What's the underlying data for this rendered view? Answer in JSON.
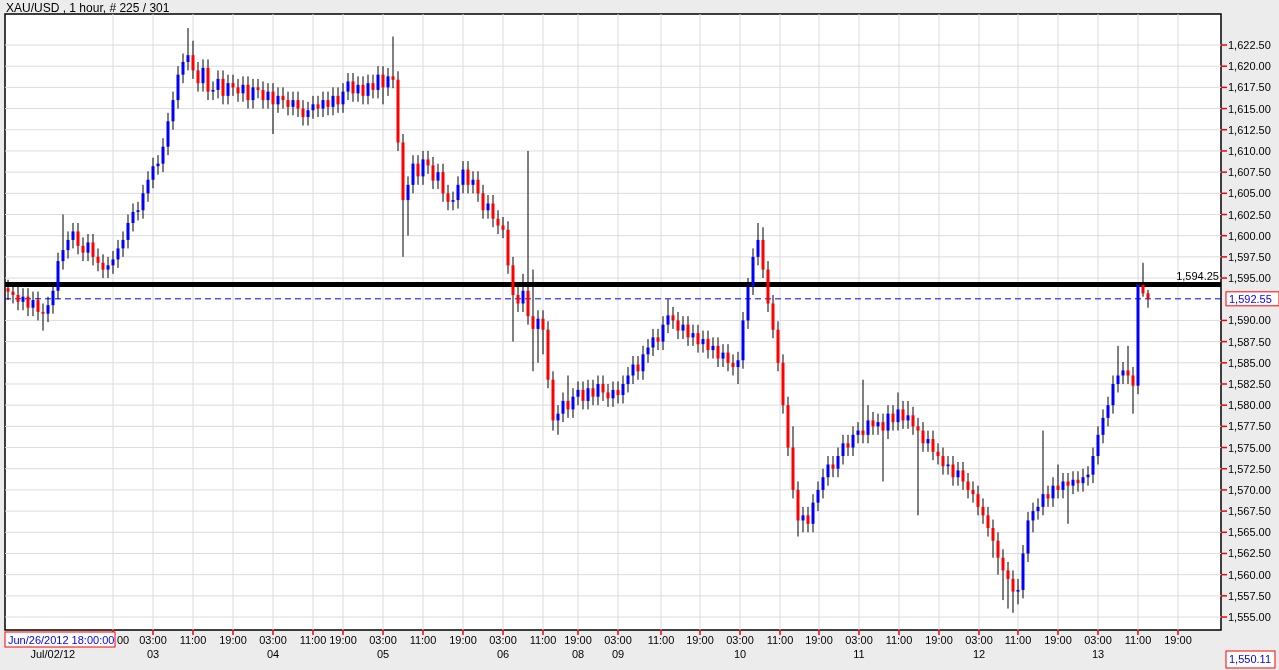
{
  "chart_title": "XAU/USD , 1 hour, # 225 / 301",
  "chart": {
    "chart_data": {
      "type": "candlestick",
      "categories": [
        null,
        null,
        null,
        null,
        null,
        null,
        null,
        null,
        null,
        null,
        null,
        null,
        null,
        null,
        null,
        null,
        null,
        null,
        null,
        null,
        null,
        null,
        null,
        null,
        null,
        null,
        null,
        null,
        null,
        null,
        null,
        null,
        null,
        null,
        null,
        null,
        null,
        null,
        null,
        null,
        null,
        null,
        null,
        null,
        null,
        null,
        null,
        null,
        null,
        null,
        null,
        null,
        null,
        null,
        null,
        null,
        null,
        null,
        null,
        null,
        null,
        null,
        null,
        null,
        null,
        null,
        null,
        null,
        null,
        null,
        null,
        null,
        null,
        null,
        null,
        null,
        null,
        null,
        null,
        null,
        null,
        null,
        null,
        null,
        null,
        null,
        null,
        null,
        null,
        null,
        null,
        null,
        null,
        null,
        null,
        null,
        null,
        null,
        null,
        null,
        null,
        null,
        null,
        null,
        null,
        null,
        null,
        null,
        null,
        null,
        null,
        null,
        null,
        null,
        null,
        null,
        null,
        null,
        null,
        null,
        null,
        null,
        null,
        null,
        null,
        null,
        null,
        null,
        null,
        null,
        null,
        null,
        null,
        null,
        null,
        null,
        null,
        null,
        null,
        null,
        null,
        null,
        null,
        null,
        null,
        null,
        null,
        null,
        null,
        null,
        null,
        null,
        null,
        null,
        null,
        null,
        null,
        null,
        null,
        null,
        null,
        null,
        null,
        null,
        null,
        null,
        null,
        null,
        null,
        null,
        null,
        null,
        null,
        null,
        null,
        null,
        null,
        null,
        null,
        null,
        null,
        null,
        null,
        null,
        null,
        null,
        null,
        null,
        null,
        null,
        null,
        null,
        null,
        null,
        null,
        null,
        null,
        null,
        null,
        null,
        null,
        null,
        null,
        null,
        null,
        null,
        null,
        null,
        null,
        null,
        null,
        null,
        null,
        null,
        null,
        null,
        null,
        null,
        null,
        null,
        null,
        null,
        null,
        null,
        null,
        null,
        null,
        null,
        null,
        null,
        null,
        null,
        null,
        null,
        null,
        null,
        null,
        null,
        null,
        null,
        null,
        null,
        null
      ],
      "ohlc": [
        [
          1593.8,
          1594.8,
          1592.4,
          1593.4
        ],
        [
          1593.4,
          1594.4,
          1592.0,
          1593.0
        ],
        [
          1593.0,
          1594.0,
          1591.2,
          1592.2
        ],
        [
          1592.2,
          1593.8,
          1591.2,
          1592.8
        ],
        [
          1592.8,
          1593.8,
          1590.5,
          1591.5
        ],
        [
          1591.5,
          1593.4,
          1590.5,
          1592.4
        ],
        [
          1592.4,
          1593.4,
          1590.0,
          1591.0
        ],
        [
          1591.0,
          1592.0,
          1588.8,
          1590.8
        ],
        [
          1590.8,
          1592.8,
          1589.8,
          1591.8
        ],
        [
          1591.8,
          1594.5,
          1590.8,
          1593.5
        ],
        [
          1593.5,
          1598.0,
          1592.5,
          1597.0
        ],
        [
          1597.0,
          1602.5,
          1596.0,
          1598.3
        ],
        [
          1598.3,
          1600.5,
          1597.3,
          1599.5
        ],
        [
          1599.5,
          1601.5,
          1598.5,
          1600.5
        ],
        [
          1600.5,
          1601.5,
          1597.8,
          1598.8
        ],
        [
          1598.8,
          1599.8,
          1597.0,
          1598.0
        ],
        [
          1598.0,
          1600.2,
          1597.0,
          1599.2
        ],
        [
          1599.2,
          1600.2,
          1596.5,
          1597.5
        ],
        [
          1597.5,
          1598.5,
          1595.8,
          1596.8
        ],
        [
          1596.8,
          1597.8,
          1595.0,
          1596.0
        ],
        [
          1596.0,
          1597.5,
          1595.0,
          1596.5
        ],
        [
          1596.5,
          1598.2,
          1595.5,
          1597.2
        ],
        [
          1597.2,
          1599.5,
          1596.2,
          1598.5
        ],
        [
          1598.5,
          1600.5,
          1597.5,
          1599.5
        ],
        [
          1599.5,
          1602.5,
          1598.5,
          1601.5
        ],
        [
          1601.5,
          1603.8,
          1600.5,
          1602.8
        ],
        [
          1602.8,
          1604.0,
          1601.8,
          1603.0
        ],
        [
          1603.0,
          1606.0,
          1602.0,
          1605.0
        ],
        [
          1605.0,
          1607.6,
          1604.0,
          1606.6
        ],
        [
          1606.6,
          1609.2,
          1605.6,
          1608.2
        ],
        [
          1608.2,
          1609.5,
          1607.2,
          1608.5
        ],
        [
          1608.5,
          1611.5,
          1607.5,
          1610.5
        ],
        [
          1610.5,
          1614.5,
          1609.5,
          1613.5
        ],
        [
          1613.5,
          1617.0,
          1612.5,
          1616.0
        ],
        [
          1616.0,
          1620.0,
          1615.0,
          1619.0
        ],
        [
          1619.0,
          1621.5,
          1618.0,
          1620.5
        ],
        [
          1620.5,
          1624.5,
          1619.5,
          1621.3
        ],
        [
          1621.3,
          1623.0,
          1618.5,
          1619.5
        ],
        [
          1619.5,
          1620.5,
          1617.0,
          1618.0
        ],
        [
          1618.0,
          1620.8,
          1617.0,
          1619.8
        ],
        [
          1619.8,
          1620.8,
          1616.0,
          1617.0
        ],
        [
          1617.0,
          1618.2,
          1616.0,
          1617.2
        ],
        [
          1617.2,
          1619.5,
          1616.2,
          1618.5
        ],
        [
          1618.5,
          1619.5,
          1615.5,
          1616.5
        ],
        [
          1616.5,
          1619.0,
          1615.5,
          1618.0
        ],
        [
          1618.0,
          1619.0,
          1616.5,
          1617.5
        ],
        [
          1617.5,
          1618.5,
          1615.8,
          1616.8
        ],
        [
          1616.8,
          1618.8,
          1615.8,
          1617.8
        ],
        [
          1617.8,
          1618.8,
          1615.0,
          1616.0
        ],
        [
          1616.0,
          1618.5,
          1615.0,
          1617.5
        ],
        [
          1617.5,
          1618.5,
          1616.2,
          1617.2
        ],
        [
          1617.2,
          1618.2,
          1615.0,
          1616.0
        ],
        [
          1616.0,
          1618.0,
          1615.0,
          1617.0
        ],
        [
          1617.0,
          1618.0,
          1612.0,
          1615.5
        ],
        [
          1615.5,
          1617.5,
          1614.5,
          1616.5
        ],
        [
          1616.5,
          1617.5,
          1615.0,
          1616.0
        ],
        [
          1616.0,
          1617.0,
          1614.2,
          1615.2
        ],
        [
          1615.2,
          1617.0,
          1614.2,
          1616.0
        ],
        [
          1616.0,
          1617.0,
          1614.0,
          1615.0
        ],
        [
          1615.0,
          1616.0,
          1613.0,
          1614.0
        ],
        [
          1614.0,
          1615.8,
          1613.0,
          1614.8
        ],
        [
          1614.8,
          1616.5,
          1613.8,
          1615.5
        ],
        [
          1615.5,
          1616.5,
          1614.0,
          1615.0
        ],
        [
          1615.0,
          1617.0,
          1614.0,
          1616.0
        ],
        [
          1616.0,
          1617.0,
          1614.2,
          1615.2
        ],
        [
          1615.2,
          1617.5,
          1614.2,
          1616.5
        ],
        [
          1616.5,
          1617.5,
          1614.5,
          1615.5
        ],
        [
          1615.5,
          1618.0,
          1614.5,
          1617.0
        ],
        [
          1617.0,
          1619.2,
          1616.0,
          1618.2
        ],
        [
          1618.2,
          1619.2,
          1615.8,
          1616.8
        ],
        [
          1616.8,
          1618.8,
          1615.8,
          1617.8
        ],
        [
          1617.8,
          1618.8,
          1615.5,
          1616.5
        ],
        [
          1616.5,
          1619.0,
          1615.5,
          1618.0
        ],
        [
          1618.0,
          1619.0,
          1616.2,
          1617.2
        ],
        [
          1617.2,
          1620.0,
          1616.2,
          1619.0
        ],
        [
          1619.0,
          1620.0,
          1615.5,
          1617.5
        ],
        [
          1617.5,
          1619.8,
          1616.5,
          1618.8
        ],
        [
          1618.8,
          1623.5,
          1617.4,
          1618.4
        ],
        [
          1618.4,
          1619.4,
          1610.0,
          1611.0
        ],
        [
          1611.0,
          1612.0,
          1597.5,
          1604.2
        ],
        [
          1604.2,
          1607.0,
          1600.0,
          1606.0
        ],
        [
          1606.0,
          1609.5,
          1605.0,
          1608.5
        ],
        [
          1608.5,
          1609.5,
          1606.0,
          1607.0
        ],
        [
          1607.0,
          1610.0,
          1606.0,
          1609.0
        ],
        [
          1609.0,
          1610.0,
          1607.3,
          1608.3
        ],
        [
          1608.3,
          1609.3,
          1605.5,
          1606.5
        ],
        [
          1606.5,
          1608.5,
          1605.5,
          1607.5
        ],
        [
          1607.5,
          1608.5,
          1604.0,
          1605.0
        ],
        [
          1605.0,
          1606.0,
          1603.0,
          1604.0
        ],
        [
          1604.0,
          1605.2,
          1603.0,
          1604.2
        ],
        [
          1604.2,
          1607.0,
          1603.2,
          1606.0
        ],
        [
          1606.0,
          1608.8,
          1605.0,
          1607.8
        ],
        [
          1607.8,
          1608.8,
          1605.0,
          1606.0
        ],
        [
          1606.0,
          1607.6,
          1605.0,
          1606.6
        ],
        [
          1606.6,
          1607.6,
          1604.0,
          1605.0
        ],
        [
          1605.0,
          1606.0,
          1602.0,
          1603.0
        ],
        [
          1603.0,
          1604.8,
          1602.0,
          1603.8
        ],
        [
          1603.8,
          1604.8,
          1601.0,
          1602.0
        ],
        [
          1602.0,
          1603.0,
          1600.2,
          1601.2
        ],
        [
          1601.2,
          1602.2,
          1599.7,
          1600.7
        ],
        [
          1600.7,
          1601.7,
          1595.5,
          1596.5
        ],
        [
          1596.5,
          1597.5,
          1587.5,
          1593.0
        ],
        [
          1593.0,
          1594.0,
          1591.0,
          1592.0
        ],
        [
          1592.0,
          1595.5,
          1591.0,
          1593.5
        ],
        [
          1593.5,
          1610.0,
          1589.5,
          1590.5
        ],
        [
          1590.5,
          1596.0,
          1584.0,
          1589.0
        ],
        [
          1589.0,
          1591.2,
          1585.0,
          1590.2
        ],
        [
          1590.2,
          1591.2,
          1586.0,
          1588.9
        ],
        [
          1588.9,
          1589.9,
          1582.0,
          1583.0
        ],
        [
          1583.0,
          1584.0,
          1577.0,
          1578.2
        ],
        [
          1578.2,
          1580.0,
          1576.5,
          1579.0
        ],
        [
          1579.0,
          1581.5,
          1578.0,
          1580.5
        ],
        [
          1580.5,
          1583.5,
          1578.5,
          1579.5
        ],
        [
          1579.5,
          1582.0,
          1578.5,
          1581.0
        ],
        [
          1581.0,
          1582.8,
          1580.0,
          1581.8
        ],
        [
          1581.8,
          1582.8,
          1579.5,
          1580.5
        ],
        [
          1580.5,
          1583.0,
          1579.5,
          1582.0
        ],
        [
          1582.0,
          1583.0,
          1580.0,
          1581.0
        ],
        [
          1581.0,
          1583.5,
          1580.0,
          1582.5
        ],
        [
          1582.5,
          1583.5,
          1580.5,
          1581.5
        ],
        [
          1581.5,
          1582.5,
          1579.8,
          1580.8
        ],
        [
          1580.8,
          1582.8,
          1579.8,
          1581.8
        ],
        [
          1581.8,
          1582.8,
          1580.2,
          1581.2
        ],
        [
          1581.2,
          1583.5,
          1580.2,
          1582.5
        ],
        [
          1582.5,
          1584.5,
          1581.5,
          1583.5
        ],
        [
          1583.5,
          1585.8,
          1582.5,
          1584.8
        ],
        [
          1584.8,
          1585.8,
          1583.0,
          1584.0
        ],
        [
          1584.0,
          1587.0,
          1583.0,
          1586.0
        ],
        [
          1586.0,
          1587.8,
          1585.0,
          1586.8
        ],
        [
          1586.8,
          1589.0,
          1585.8,
          1588.0
        ],
        [
          1588.0,
          1589.0,
          1586.5,
          1587.5
        ],
        [
          1587.5,
          1590.5,
          1586.5,
          1589.5
        ],
        [
          1589.5,
          1592.5,
          1588.5,
          1590.6
        ],
        [
          1590.6,
          1591.6,
          1589.0,
          1590.0
        ],
        [
          1590.0,
          1591.0,
          1587.8,
          1588.8
        ],
        [
          1588.8,
          1590.5,
          1587.8,
          1589.5
        ],
        [
          1589.5,
          1590.5,
          1587.0,
          1588.0
        ],
        [
          1588.0,
          1589.5,
          1587.0,
          1588.5
        ],
        [
          1588.5,
          1589.5,
          1586.2,
          1587.2
        ],
        [
          1587.2,
          1588.8,
          1586.2,
          1587.8
        ],
        [
          1587.8,
          1588.8,
          1585.5,
          1586.5
        ],
        [
          1586.5,
          1588.0,
          1585.5,
          1587.0
        ],
        [
          1587.0,
          1588.0,
          1584.5,
          1585.5
        ],
        [
          1585.5,
          1587.2,
          1584.5,
          1586.2
        ],
        [
          1586.2,
          1587.2,
          1584.0,
          1585.0
        ],
        [
          1585.0,
          1586.0,
          1583.5,
          1584.5
        ],
        [
          1584.5,
          1586.3,
          1582.5,
          1585.3
        ],
        [
          1585.3,
          1591.0,
          1584.3,
          1590.0
        ],
        [
          1590.0,
          1595.0,
          1589.0,
          1594.0
        ],
        [
          1594.0,
          1598.5,
          1593.0,
          1597.5
        ],
        [
          1597.5,
          1601.5,
          1596.5,
          1599.5
        ],
        [
          1599.5,
          1601.0,
          1595.0,
          1596.0
        ],
        [
          1596.0,
          1597.0,
          1591.0,
          1592.0
        ],
        [
          1592.0,
          1593.0,
          1587.9,
          1588.9
        ],
        [
          1588.9,
          1589.9,
          1584.0,
          1585.0
        ],
        [
          1585.0,
          1586.0,
          1579.0,
          1580.0
        ],
        [
          1580.0,
          1581.0,
          1574.0,
          1575.0
        ],
        [
          1575.0,
          1577.5,
          1569.0,
          1570.0
        ],
        [
          1570.0,
          1571.0,
          1564.5,
          1566.4
        ],
        [
          1566.4,
          1568.0,
          1565.0,
          1567.0
        ],
        [
          1567.0,
          1568.0,
          1565.0,
          1566.0
        ],
        [
          1566.0,
          1569.5,
          1565.0,
          1568.5
        ],
        [
          1568.5,
          1571.0,
          1567.5,
          1570.0
        ],
        [
          1570.0,
          1572.5,
          1569.0,
          1571.5
        ],
        [
          1571.5,
          1574.0,
          1570.5,
          1573.0
        ],
        [
          1573.0,
          1574.0,
          1571.5,
          1572.5
        ],
        [
          1572.5,
          1575.0,
          1571.5,
          1574.0
        ],
        [
          1574.0,
          1576.5,
          1573.0,
          1575.5
        ],
        [
          1575.5,
          1576.5,
          1574.0,
          1575.0
        ],
        [
          1575.0,
          1577.5,
          1574.0,
          1576.5
        ],
        [
          1576.5,
          1578.0,
          1575.5,
          1577.0
        ],
        [
          1577.0,
          1583.0,
          1575.5,
          1576.5
        ],
        [
          1576.5,
          1580.0,
          1575.5,
          1578.2
        ],
        [
          1578.2,
          1579.2,
          1576.5,
          1577.5
        ],
        [
          1577.5,
          1579.0,
          1576.5,
          1578.0
        ],
        [
          1578.0,
          1579.0,
          1571.0,
          1577.0
        ],
        [
          1577.0,
          1580.0,
          1576.0,
          1579.0
        ],
        [
          1579.0,
          1580.0,
          1577.0,
          1578.0
        ],
        [
          1578.0,
          1581.5,
          1577.0,
          1579.5
        ],
        [
          1579.5,
          1580.5,
          1577.2,
          1578.2
        ],
        [
          1578.2,
          1580.5,
          1577.2,
          1578.8
        ],
        [
          1578.8,
          1579.8,
          1576.5,
          1577.5
        ],
        [
          1577.5,
          1578.5,
          1567.0,
          1577.0
        ],
        [
          1577.0,
          1578.0,
          1574.5,
          1575.5
        ],
        [
          1575.5,
          1577.0,
          1574.5,
          1576.0
        ],
        [
          1576.0,
          1577.0,
          1573.5,
          1574.5
        ],
        [
          1574.5,
          1575.5,
          1573.0,
          1574.0
        ],
        [
          1574.0,
          1575.0,
          1571.8,
          1572.8
        ],
        [
          1572.8,
          1574.0,
          1571.8,
          1573.0
        ],
        [
          1573.0,
          1574.0,
          1570.5,
          1571.5
        ],
        [
          1571.5,
          1573.3,
          1570.5,
          1572.3
        ],
        [
          1572.3,
          1573.3,
          1570.0,
          1571.0
        ],
        [
          1571.0,
          1572.0,
          1569.0,
          1570.0
        ],
        [
          1570.0,
          1571.0,
          1568.5,
          1569.5
        ],
        [
          1569.5,
          1570.5,
          1567.0,
          1568.0
        ],
        [
          1568.0,
          1569.0,
          1566.0,
          1567.0
        ],
        [
          1567.0,
          1568.0,
          1564.5,
          1565.5
        ],
        [
          1565.5,
          1566.5,
          1562.0,
          1564.0
        ],
        [
          1564.0,
          1565.0,
          1560.0,
          1562.0
        ],
        [
          1562.0,
          1563.0,
          1557.0,
          1560.5
        ],
        [
          1560.5,
          1561.5,
          1556.0,
          1559.5
        ],
        [
          1559.5,
          1560.5,
          1555.5,
          1558.0
        ],
        [
          1558.0,
          1559.5,
          1556.5,
          1558.2
        ],
        [
          1558.2,
          1563.5,
          1557.2,
          1562.5
        ],
        [
          1562.5,
          1567.4,
          1561.5,
          1566.4
        ],
        [
          1566.4,
          1568.5,
          1565.0,
          1567.5
        ],
        [
          1567.5,
          1569.0,
          1566.5,
          1568.0
        ],
        [
          1568.0,
          1577.0,
          1567.0,
          1569.5
        ],
        [
          1569.5,
          1570.5,
          1568.0,
          1569.0
        ],
        [
          1569.0,
          1571.5,
          1568.0,
          1570.5
        ],
        [
          1570.5,
          1573.0,
          1569.0,
          1570.0
        ],
        [
          1570.0,
          1572.0,
          1569.0,
          1571.0
        ],
        [
          1571.0,
          1572.0,
          1566.0,
          1570.5
        ],
        [
          1570.5,
          1572.2,
          1569.5,
          1571.2
        ],
        [
          1571.2,
          1572.2,
          1569.8,
          1570.8
        ],
        [
          1570.8,
          1572.5,
          1569.8,
          1571.5
        ],
        [
          1571.5,
          1572.8,
          1570.5,
          1571.8
        ],
        [
          1571.8,
          1575.0,
          1570.8,
          1574.0
        ],
        [
          1574.0,
          1577.5,
          1573.0,
          1576.5
        ],
        [
          1576.5,
          1579.5,
          1575.5,
          1578.5
        ],
        [
          1578.5,
          1581.0,
          1577.5,
          1580.0
        ],
        [
          1580.0,
          1583.5,
          1579.0,
          1582.5
        ],
        [
          1582.5,
          1587.0,
          1581.5,
          1583.5
        ],
        [
          1583.5,
          1585.1,
          1582.5,
          1584.1
        ],
        [
          1584.1,
          1587.0,
          1582.5,
          1583.5
        ],
        [
          1583.5,
          1584.5,
          1579.0,
          1582.3
        ],
        [
          1582.3,
          1594.5,
          1581.3,
          1594.2
        ],
        [
          1594.2,
          1596.8,
          1592.8,
          1593.2
        ],
        [
          1593.2,
          1593.6,
          1591.5,
          1592.55
        ],
        null,
        null,
        null,
        null,
        null,
        null,
        null,
        null,
        null,
        null,
        null,
        null,
        null,
        null
      ],
      "yticks": [
        {
          "value": 1622.5,
          "label": "1,622.50"
        },
        {
          "value": 1620,
          "label": "1,620.00"
        },
        {
          "value": 1617.5,
          "label": "1,617.50"
        },
        {
          "value": 1615,
          "label": "1,615.00"
        },
        {
          "value": 1612.5,
          "label": "1,612.50"
        },
        {
          "value": 1610,
          "label": "1,610.00"
        },
        {
          "value": 1607.5,
          "label": "1,607.50"
        },
        {
          "value": 1605,
          "label": "1,605.00"
        },
        {
          "value": 1602.5,
          "label": "1,602.50"
        },
        {
          "value": 1600,
          "label": "1,600.00"
        },
        {
          "value": 1597.5,
          "label": "1,597.50"
        },
        {
          "value": 1595,
          "label": "1,595.00"
        },
        {
          "value": 1590,
          "label": "1,590.00"
        },
        {
          "value": 1587.5,
          "label": "1,587.50"
        },
        {
          "value": 1585,
          "label": "1,585.00"
        },
        {
          "value": 1582.5,
          "label": "1,582.50"
        },
        {
          "value": 1580,
          "label": "1,580.00"
        },
        {
          "value": 1577.5,
          "label": "1,577.50"
        },
        {
          "value": 1575,
          "label": "1,575.00"
        },
        {
          "value": 1572.5,
          "label": "1,572.50"
        },
        {
          "value": 1570,
          "label": "1,570.00"
        },
        {
          "value": 1567.5,
          "label": "1,567.50"
        },
        {
          "value": 1565,
          "label": "1,565.00"
        },
        {
          "value": 1562.5,
          "label": "1,562.50"
        },
        {
          "value": 1560,
          "label": "1,560.00"
        },
        {
          "value": 1557.5,
          "label": "1,557.50"
        },
        {
          "value": 1555,
          "label": "1,555.00"
        }
      ],
      "ylim": [
        1553.47,
        1626.16
      ],
      "grid": true,
      "ref_lines": [
        {
          "axis": "y",
          "value": 1594.25,
          "label": "1,594.25"
        },
        {
          "axis": "y",
          "value": 1592.55,
          "label": "1,592.55"
        }
      ]
    },
    "time_labels": [
      "00",
      "03:00",
      "11:00",
      "19:00",
      "03:00",
      "11:00",
      "19:00",
      "03:00",
      "11:00",
      "19:00",
      "03:00",
      "11:00",
      "19:00",
      "03:00",
      "11:00",
      "19:00",
      "03:00",
      "11:00",
      "19:00",
      "03:00",
      "11:00",
      "19:00",
      "03:00",
      "11:00",
      "19:00",
      "03:00",
      "11:00",
      "19:00"
    ],
    "day_labels": [
      "Jul/02/12",
      "03",
      "04",
      "05",
      "06",
      "08",
      "09",
      "10",
      "11",
      "12",
      "13"
    ]
  },
  "cursor_time": "Jun/26/2012 18:00:00",
  "cursor_price": "1,550.11"
}
